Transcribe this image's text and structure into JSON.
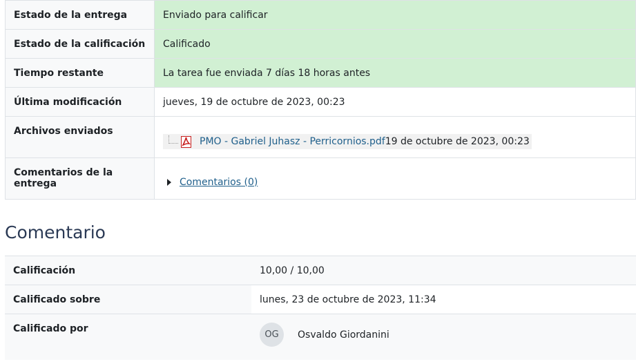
{
  "submission_status": {
    "rows": [
      {
        "label": "Estado de la entrega",
        "value": "Enviado para calificar"
      },
      {
        "label": "Estado de la calificación",
        "value": "Calificado"
      },
      {
        "label": "Tiempo restante",
        "value": "La tarea fue enviada 7 días 18 horas antes"
      },
      {
        "label": "Última modificación",
        "value": "jueves, 19 de octubre de 2023, 00:23"
      },
      {
        "label": "Archivos enviados"
      },
      {
        "label": "Comentarios de la entrega"
      }
    ],
    "file": {
      "name": "PMO - Gabriel Juhasz - Perricornios.pdf",
      "date": "19 de octubre de 2023, 00:23",
      "icon": "pdf-icon"
    },
    "comments_link": "Comentarios (0)"
  },
  "feedback": {
    "title": "Comentario",
    "rows": [
      {
        "label": "Calificación",
        "value": "10,00 / 10,00"
      },
      {
        "label": "Calificado sobre",
        "value": "lunes, 23 de octubre de 2023, 11:34"
      },
      {
        "label": "Calificado por"
      }
    ],
    "grader": {
      "initials": "OG",
      "name": "Osvaldo Giordanini"
    }
  },
  "colors": {
    "success_bg": "#d1f0d3",
    "link": "#1f5f8b",
    "header_bg": "#f8f9fa"
  }
}
